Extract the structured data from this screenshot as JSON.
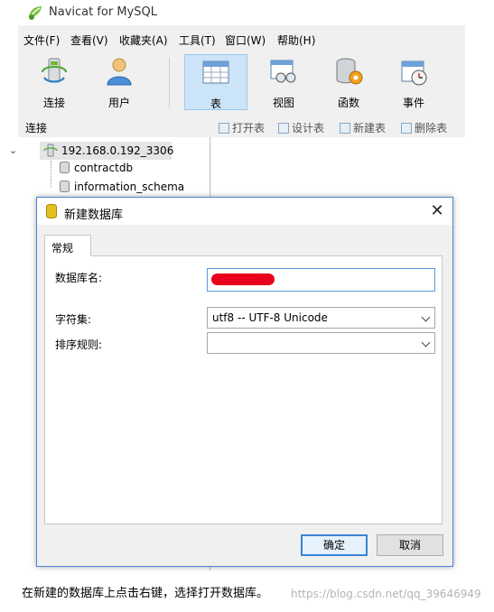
{
  "window": {
    "title": "Navicat for MySQL"
  },
  "menu": [
    "文件(F)",
    "查看(V)",
    "收藏夹(A)",
    "工具(T)",
    "窗口(W)",
    "帮助(H)"
  ],
  "toolbar": {
    "items": [
      {
        "label": "连接",
        "icon": "connection-icon"
      },
      {
        "label": "用户",
        "icon": "user-icon"
      },
      {
        "label": "表",
        "icon": "table-icon",
        "active": true
      },
      {
        "label": "视图",
        "icon": "view-icon"
      },
      {
        "label": "函数",
        "icon": "function-icon"
      },
      {
        "label": "事件",
        "icon": "event-icon"
      }
    ]
  },
  "subbar": {
    "section": "连接",
    "buttons": [
      "打开表",
      "设计表",
      "新建表",
      "删除表"
    ]
  },
  "tree": {
    "connection": "192.168.0.192_3306",
    "databases": [
      "contractdb",
      "information_schema"
    ]
  },
  "dialog": {
    "title": "新建数据库",
    "tab": "常规",
    "db_name_label": "数据库名:",
    "charset_label": "字符集:",
    "charset_value": "utf8 -- UTF-8 Unicode",
    "collation_label": "排序规则:",
    "collation_value": "",
    "ok_label": "确定",
    "cancel_label": "取消"
  },
  "caption": "在新建的数据库上点击右键，选择打开数据库。",
  "watermark": "https://blog.csdn.net/qq_39646949",
  "colors": {
    "accent": "#3a83d5",
    "active_tool": "#cce4f7",
    "redaction": "#e8001c"
  }
}
